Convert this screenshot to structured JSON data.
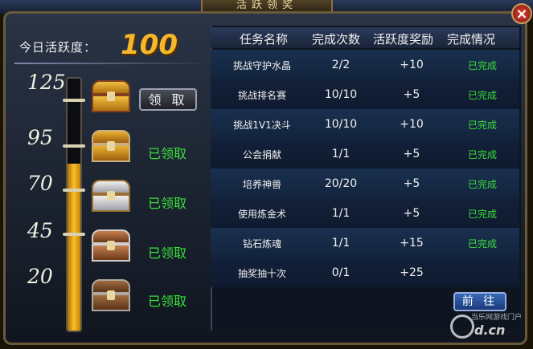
{
  "window": {
    "title": "活跃领奖",
    "close_label": "×"
  },
  "activity": {
    "label": "今日活跃度：",
    "value": "100",
    "max": 125,
    "progress": 100,
    "ticks": [
      "125",
      "95",
      "70",
      "45",
      "20"
    ]
  },
  "rewards": [
    {
      "threshold": "125",
      "chest": "golden-ornate-chest-icon",
      "status": "领 取",
      "claimable": true
    },
    {
      "threshold": "95",
      "chest": "gold-chest-icon",
      "status": "已领取",
      "claimable": false
    },
    {
      "threshold": "70",
      "chest": "silver-chest-icon",
      "status": "已领取",
      "claimable": false
    },
    {
      "threshold": "45",
      "chest": "bronze-chest-icon",
      "status": "已领取",
      "claimable": false
    },
    {
      "threshold": "20",
      "chest": "wooden-chest-icon",
      "status": "已领取",
      "claimable": false
    }
  ],
  "table": {
    "headers": [
      "任务名称",
      "完成次数",
      "活跃度奖励",
      "完成情况"
    ],
    "rows": [
      {
        "name": "挑战守护水晶",
        "count": "2/2",
        "reward": "+10",
        "status": "已完成"
      },
      {
        "name": "挑战排名赛",
        "count": "10/10",
        "reward": "+5",
        "status": "已完成"
      },
      {
        "name": "挑战1V1决斗",
        "count": "10/10",
        "reward": "+10",
        "status": "已完成"
      },
      {
        "name": "公会捐献",
        "count": "1/1",
        "reward": "+5",
        "status": "已完成"
      },
      {
        "name": "培养神兽",
        "count": "20/20",
        "reward": "+5",
        "status": "已完成"
      },
      {
        "name": "使用炼金术",
        "count": "1/1",
        "reward": "+5",
        "status": "已完成"
      },
      {
        "name": "钻石炼魂",
        "count": "1/1",
        "reward": "+15",
        "status": "已完成"
      },
      {
        "name": "抽奖抽十次",
        "count": "0/1",
        "reward": "+25",
        "status": "前 往"
      }
    ]
  },
  "watermark": {
    "text": "当乐网游戏门户",
    "url": "d.cn"
  },
  "colors": {
    "accent_gold": "#f5b82a",
    "done_green": "#38e038",
    "header_blue": "#2a3a5a"
  }
}
